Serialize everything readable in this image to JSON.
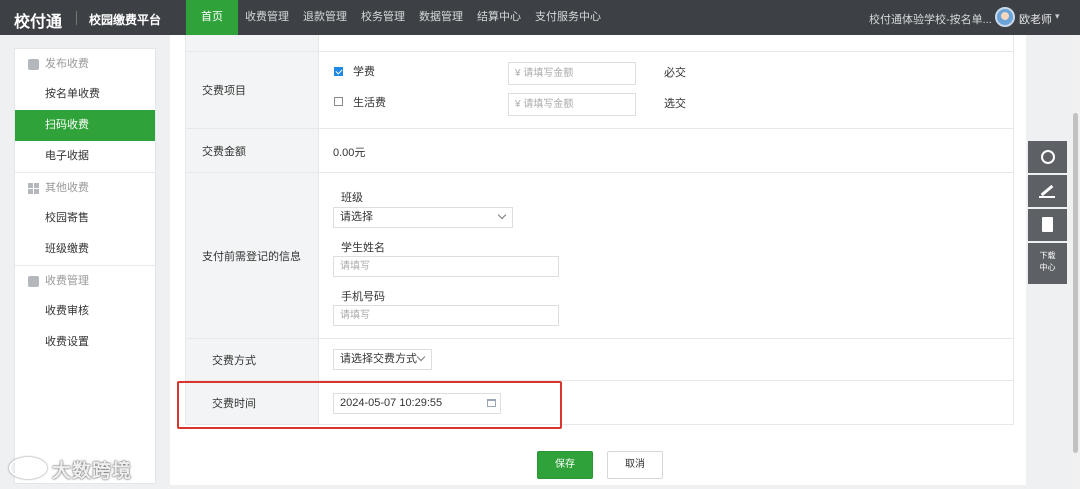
{
  "topbar": {
    "logo": "校付通",
    "app_title": "校园缴费平台",
    "nav": [
      "首页",
      "收费管理",
      "退款管理",
      "校务管理",
      "数据管理",
      "结算中心",
      "支付服务中心"
    ],
    "school": "校付通体验学校-按名单...",
    "user": "欧老师"
  },
  "sidebar": {
    "groups": [
      {
        "title": "发布收费",
        "items": [
          "按名单收费",
          "扫码收费",
          "电子收据"
        ]
      },
      {
        "title": "其他收费",
        "items": [
          "校园寄售",
          "班级缴费"
        ]
      },
      {
        "title": "收费管理",
        "items": [
          "收费审核",
          "收费设置"
        ]
      }
    ],
    "active_item": "扫码收费"
  },
  "form": {
    "items_label": "交费项目",
    "items": [
      {
        "name": "学费",
        "checked": true,
        "amount_placeholder": "¥ 请填写金额",
        "rule": "必交"
      },
      {
        "name": "生活费",
        "checked": false,
        "amount_placeholder": "¥ 请填写金额",
        "rule": "选交"
      }
    ],
    "amount_label": "交费金额",
    "amount_value": "0.00元",
    "info_label": "支付前需登记的信息",
    "class_label": "班级",
    "class_select": "请选择",
    "name_label": "学生姓名",
    "name_placeholder": "请填写",
    "phone_label": "手机号码",
    "phone_placeholder": "请填写",
    "method_label": "交费方式",
    "method_select": "请选择交费方式",
    "time_label": "交费时间",
    "time_value": "2024-05-07 10:29:55"
  },
  "buttons": {
    "save": "保存",
    "cancel": "取消"
  },
  "tools": {
    "download": "下载中心"
  },
  "watermark": "大数跨境",
  "colors": {
    "brand_green": "#2fa33a",
    "topbar": "#3d4044",
    "highlight_red": "#d9352b"
  }
}
